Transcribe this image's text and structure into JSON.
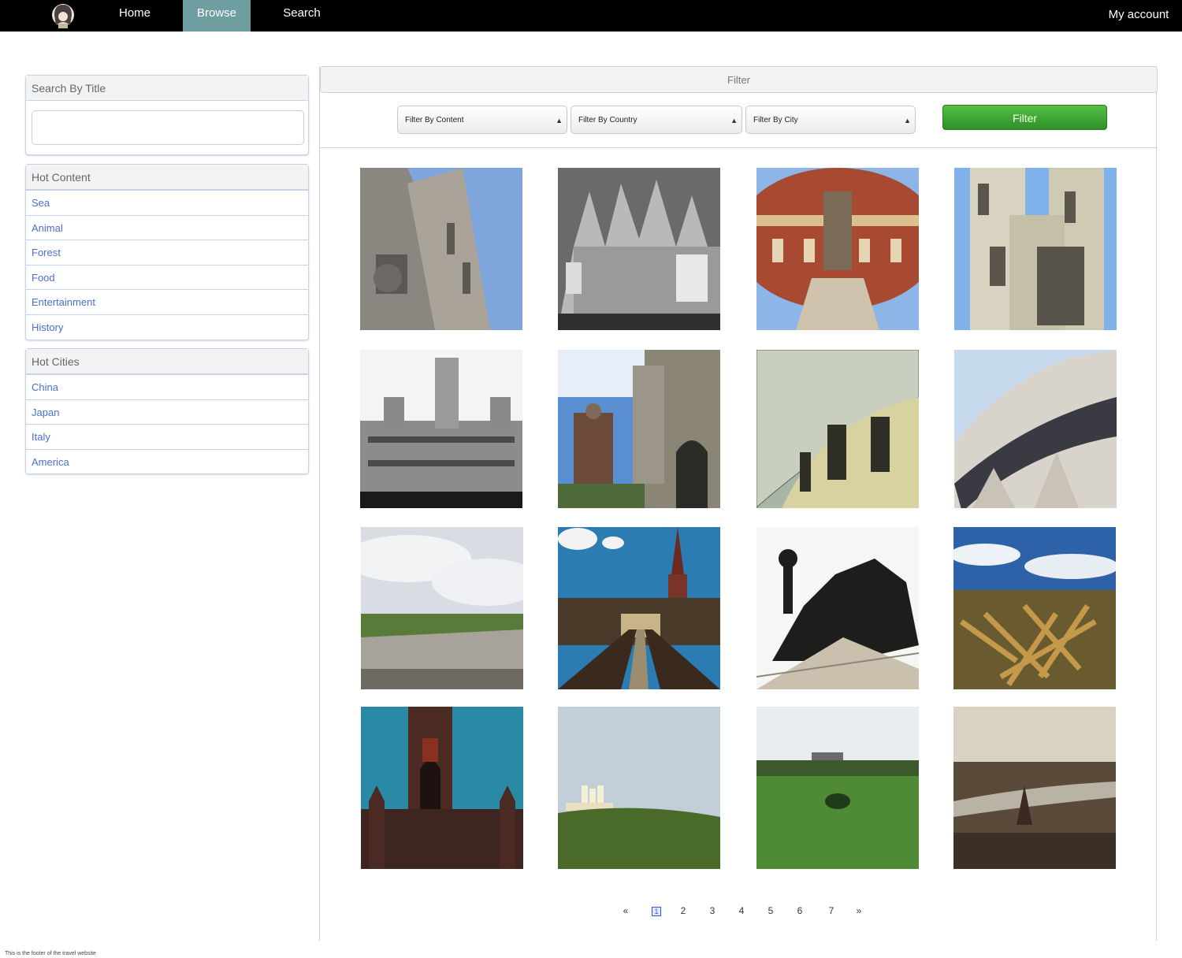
{
  "nav": {
    "home": "Home",
    "browse": "Browse",
    "search": "Search",
    "account": "My account",
    "active": "Browse"
  },
  "sidebar": {
    "search_title": "Search By Title",
    "search_value": "",
    "hot_content": {
      "title": "Hot Content",
      "items": [
        "Sea",
        "Animal",
        "Forest",
        "Food",
        "Entertainment",
        "History"
      ]
    },
    "hot_cities": {
      "title": "Hot Cities",
      "items": [
        "China",
        "Japan",
        "Italy",
        "America"
      ]
    }
  },
  "filter": {
    "title": "Filter",
    "content_select": "Filter By Content",
    "country_select": "Filter By Country",
    "city_select": "Filter By City",
    "button": "Filter"
  },
  "pagination": {
    "prev": "«",
    "pages": [
      "1",
      "2",
      "3",
      "4",
      "5",
      "6",
      "7"
    ],
    "current": "1",
    "next": "»"
  },
  "footer": "This is the footer of the travel website"
}
